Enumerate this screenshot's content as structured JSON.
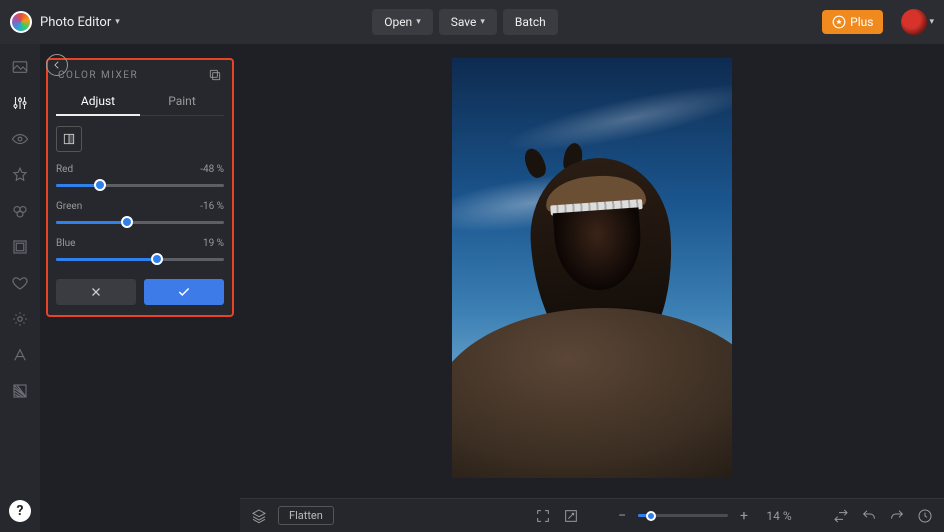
{
  "header": {
    "app_title": "Photo Editor",
    "open_label": "Open",
    "save_label": "Save",
    "batch_label": "Batch",
    "plus_label": "Plus"
  },
  "panel": {
    "title": "COLOR MIXER",
    "tabs": {
      "adjust": "Adjust",
      "paint": "Paint"
    },
    "sliders": {
      "red": {
        "label": "Red",
        "value_text": "-48 %",
        "percent": 26
      },
      "green": {
        "label": "Green",
        "value_text": "-16 %",
        "percent": 42
      },
      "blue": {
        "label": "Blue",
        "value_text": "19 %",
        "percent": 60
      }
    }
  },
  "bottombar": {
    "flatten_label": "Flatten",
    "zoom_text": "14 %"
  }
}
